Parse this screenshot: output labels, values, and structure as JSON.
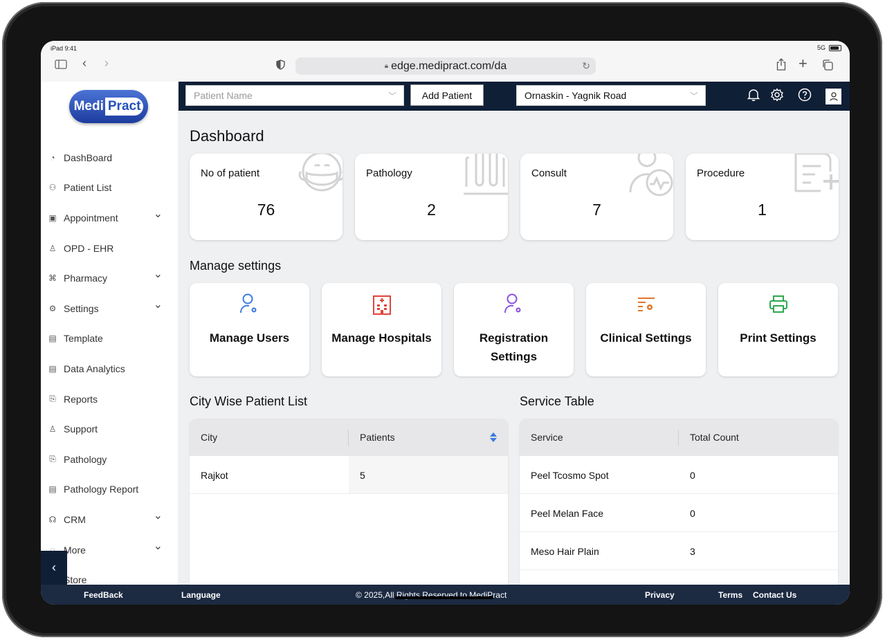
{
  "status": {
    "time": "iPad 9:41",
    "network": "5G"
  },
  "browser": {
    "url": "edge.medipract.com/da"
  },
  "logo": {
    "part1": "Medi",
    "part2": "Pract"
  },
  "sidebar": {
    "items": [
      {
        "label": "DashBoard",
        "icon": "dashboard-icon",
        "glyph": "◔",
        "chevron": false
      },
      {
        "label": "Patient List",
        "icon": "patient-list-icon",
        "glyph": "⚇",
        "chevron": false
      },
      {
        "label": "Appointment",
        "icon": "calendar-icon",
        "glyph": "▣",
        "chevron": true
      },
      {
        "label": "OPD - EHR",
        "icon": "person-icon",
        "glyph": "♙",
        "chevron": false
      },
      {
        "label": "Pharmacy",
        "icon": "pharmacy-icon",
        "glyph": "⌘",
        "chevron": true
      },
      {
        "label": "Settings",
        "icon": "gear-icon",
        "glyph": "⚙",
        "chevron": true
      },
      {
        "label": "Template",
        "icon": "template-icon",
        "glyph": "▤",
        "chevron": false
      },
      {
        "label": "Data Analytics",
        "icon": "analytics-icon",
        "glyph": "▤",
        "chevron": false
      },
      {
        "label": "Reports",
        "icon": "reports-icon",
        "glyph": "⎘",
        "chevron": false
      },
      {
        "label": "Support",
        "icon": "support-icon",
        "glyph": "♙",
        "chevron": false
      },
      {
        "label": "Pathology",
        "icon": "pathology-icon",
        "glyph": "⎘",
        "chevron": false
      },
      {
        "label": "Pathology Report",
        "icon": "report-doc-icon",
        "glyph": "▤",
        "chevron": false
      },
      {
        "label": "CRM",
        "icon": "headset-icon",
        "glyph": "☊",
        "chevron": true
      },
      {
        "label": "More",
        "icon": "more-icon",
        "glyph": "◌",
        "chevron": true
      },
      {
        "label": "Store",
        "icon": "store-icon",
        "glyph": "",
        "chevron": false
      }
    ]
  },
  "topbar": {
    "patient_placeholder": "Patient Name",
    "add_patient": "Add Patient",
    "clinic": "Ornaskin - Yagnik Road"
  },
  "dashboard": {
    "title": "Dashboard",
    "stats": [
      {
        "label": "No of patient",
        "value": "76"
      },
      {
        "label": "Pathology",
        "value": "2"
      },
      {
        "label": "Consult",
        "value": "7"
      },
      {
        "label": "Procedure",
        "value": "1"
      }
    ]
  },
  "manage": {
    "title": "Manage settings",
    "cards": [
      {
        "label": "Manage Users",
        "icon": "user-gear-icon",
        "color": "#3b7be0"
      },
      {
        "label": "Manage Hospitals",
        "icon": "hospital-icon",
        "color": "#e0453b"
      },
      {
        "label": "Registration Settings",
        "icon": "user-gear-icon",
        "color": "#8a4fe0"
      },
      {
        "label": "Clinical Settings",
        "icon": "list-gear-icon",
        "color": "#e0772b"
      },
      {
        "label": "Print Settings",
        "icon": "printer-icon",
        "color": "#2fa84f"
      }
    ]
  },
  "city_table": {
    "title": "City Wise Patient List",
    "headers": [
      "City",
      "Patients"
    ],
    "rows": [
      [
        "Rajkot",
        "5"
      ]
    ]
  },
  "service_table": {
    "title": "Service Table",
    "headers": [
      "Service",
      "Total Count"
    ],
    "rows": [
      [
        "Peel Tcosmo Spot",
        "0"
      ],
      [
        "Peel Melan Face",
        "0"
      ],
      [
        "Meso Hair Plain",
        "3"
      ]
    ]
  },
  "footer": {
    "feedback": "FeedBack",
    "language": "Language",
    "copyright": "© 2025,All Rights Reserved to MediPract",
    "privacy": "Privacy",
    "terms": "Terms",
    "contact": "Contact Us"
  }
}
